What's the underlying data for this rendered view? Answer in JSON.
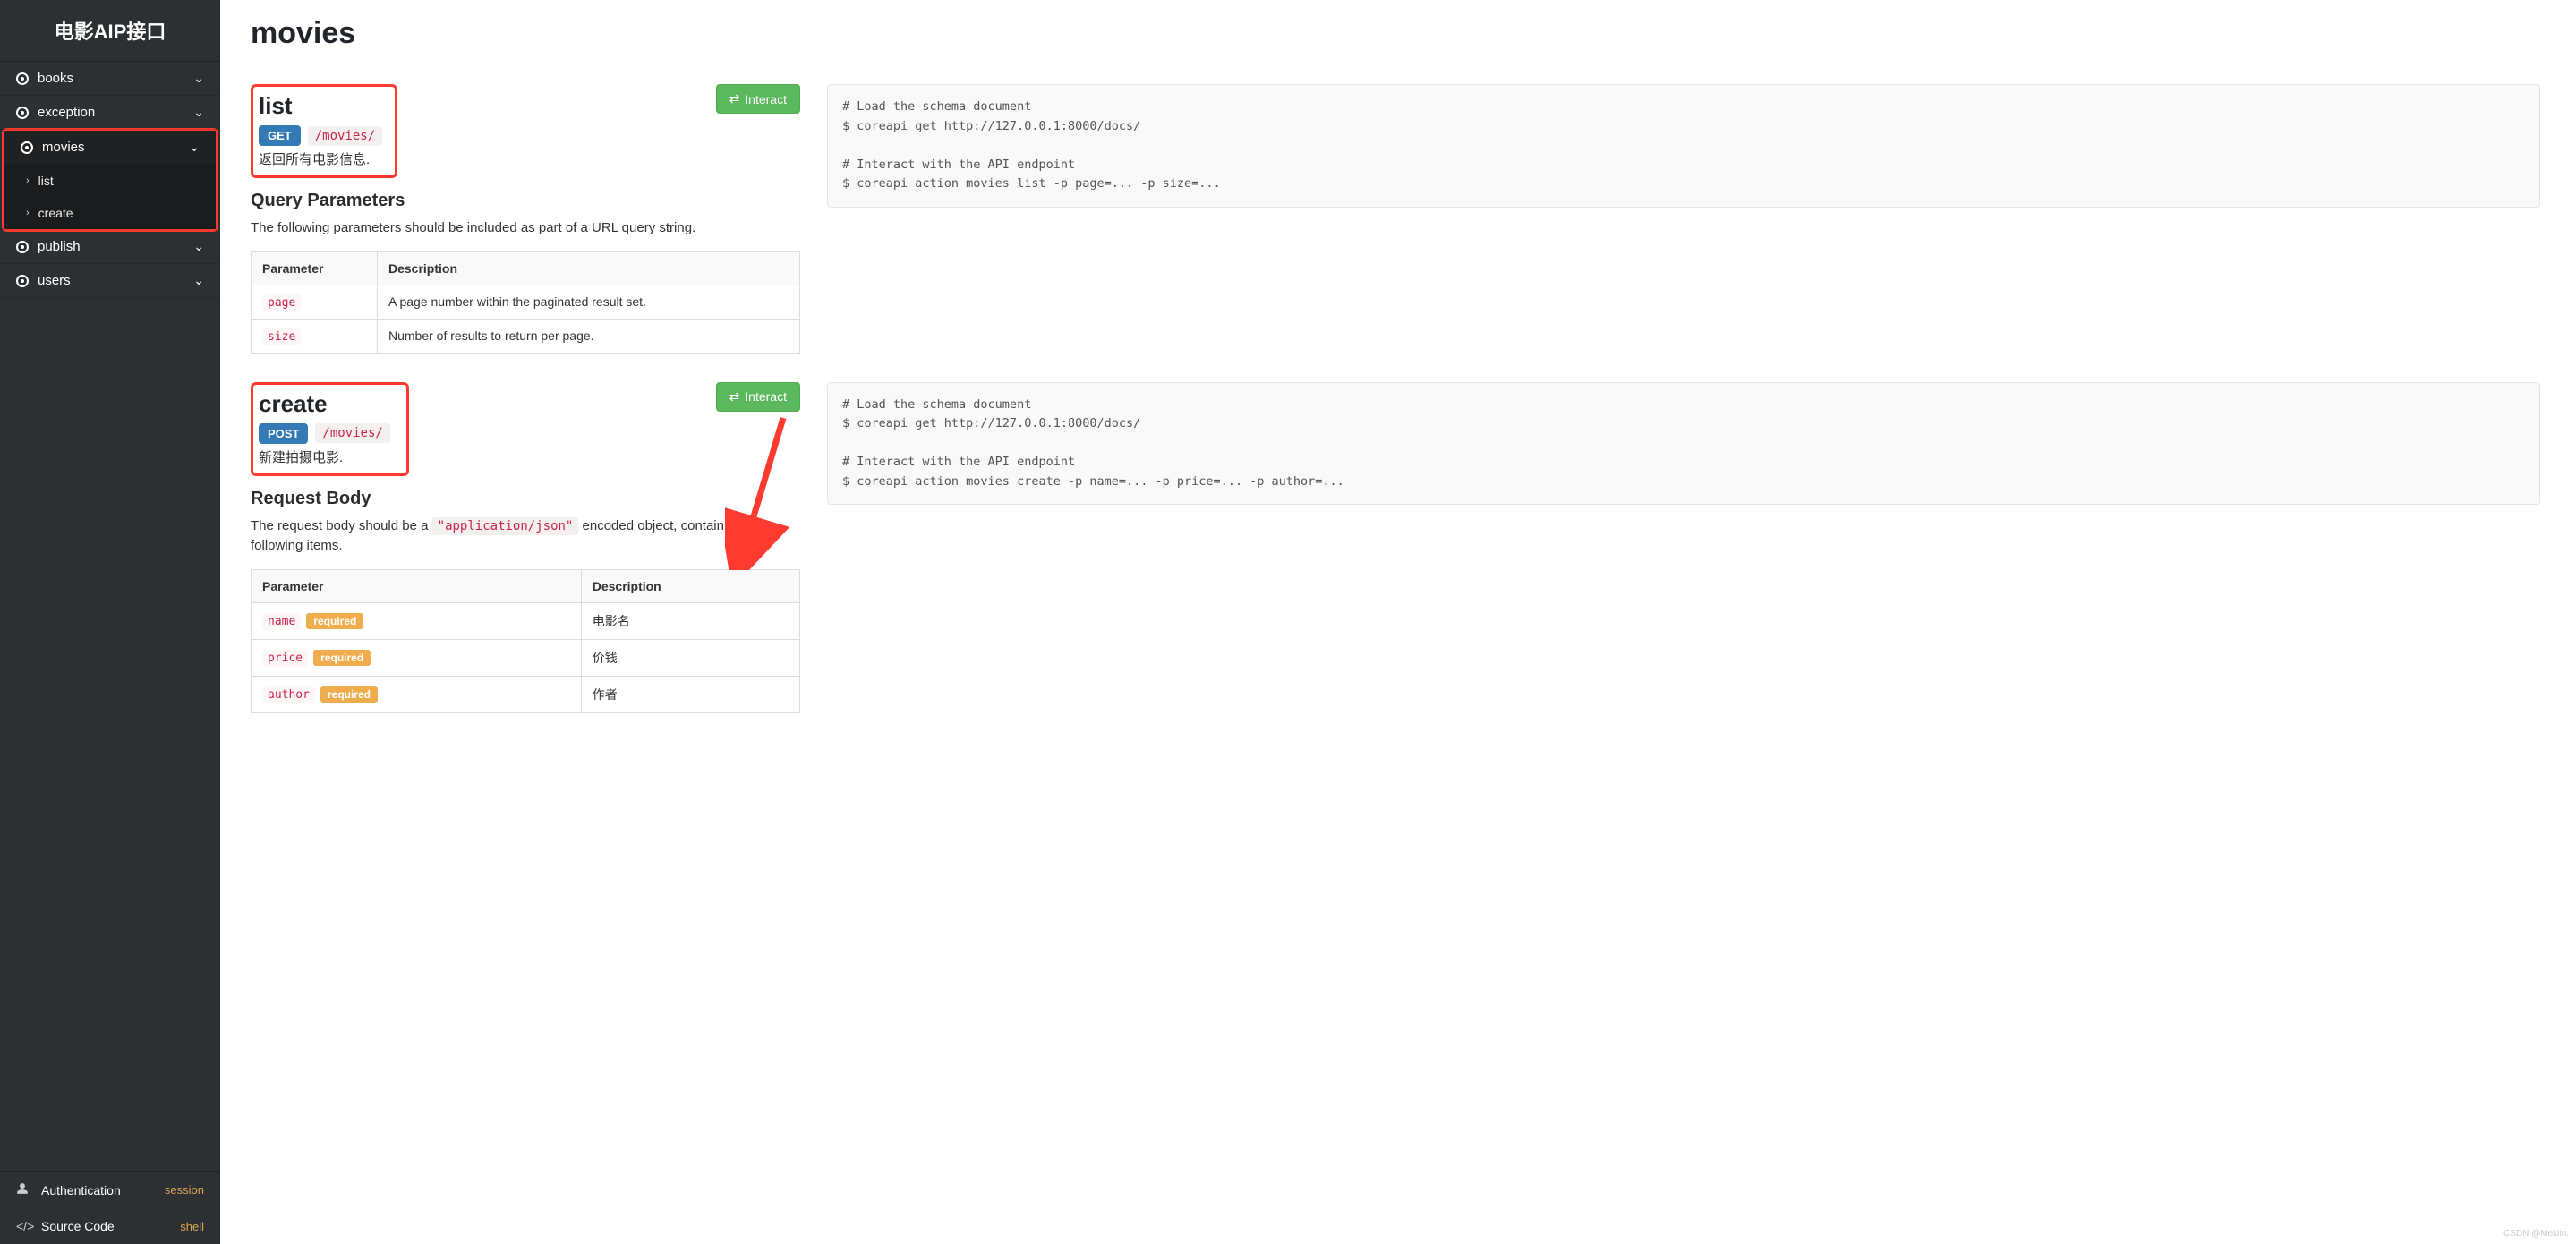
{
  "sidebar": {
    "title": "电影AIP接口",
    "items": [
      {
        "label": "books"
      },
      {
        "label": "exception"
      },
      {
        "label": "movies",
        "active": true
      },
      {
        "label": "publish"
      },
      {
        "label": "users"
      }
    ],
    "subitems": [
      {
        "label": "list"
      },
      {
        "label": "create"
      }
    ],
    "footer": {
      "auth_label": "Authentication",
      "auth_value": "session",
      "source_label": "Source Code",
      "source_value": "shell"
    }
  },
  "page": {
    "title": "movies"
  },
  "endpoints": {
    "list": {
      "name": "list",
      "method": "GET",
      "path": "/movies/",
      "desc": "返回所有电影信息.",
      "interact_label": "Interact",
      "section_title": "Query Parameters",
      "section_desc": "The following parameters should be included as part of a URL query string.",
      "th_param": "Parameter",
      "th_desc": "Description",
      "params": [
        {
          "name": "page",
          "desc": "A page number within the paginated result set."
        },
        {
          "name": "size",
          "desc": "Number of results to return per page."
        }
      ],
      "code": "# Load the schema document\n$ coreapi get http://127.0.0.1:8000/docs/\n\n# Interact with the API endpoint\n$ coreapi action movies list -p page=... -p size=..."
    },
    "create": {
      "name": "create",
      "method": "POST",
      "path": "/movies/",
      "desc": "新建拍摄电影.",
      "interact_label": "Interact",
      "section_title": "Request Body",
      "section_desc_pre": "The request body should be a ",
      "section_desc_code": "\"application/json\"",
      "section_desc_post": " encoded object, containing the following items.",
      "th_param": "Parameter",
      "th_desc": "Description",
      "required_label": "required",
      "params": [
        {
          "name": "name",
          "desc": "电影名"
        },
        {
          "name": "price",
          "desc": "价钱"
        },
        {
          "name": "author",
          "desc": "作者"
        }
      ],
      "code": "# Load the schema document\n$ coreapi get http://127.0.0.1:8000/docs/\n\n# Interact with the API endpoint\n$ coreapi action movies create -p name=... -p price=... -p author=..."
    }
  },
  "watermark": "CSDN @MeiJin."
}
